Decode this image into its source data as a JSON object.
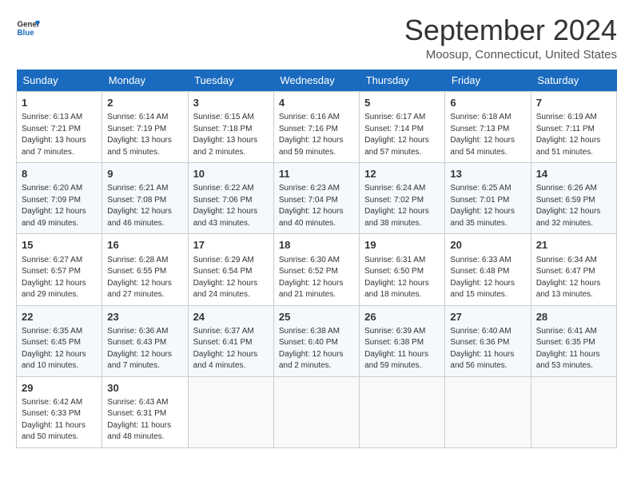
{
  "header": {
    "logo_line1": "General",
    "logo_line2": "Blue",
    "month": "September 2024",
    "location": "Moosup, Connecticut, United States"
  },
  "days_of_week": [
    "Sunday",
    "Monday",
    "Tuesday",
    "Wednesday",
    "Thursday",
    "Friday",
    "Saturday"
  ],
  "weeks": [
    [
      {
        "day": "1",
        "info": "Sunrise: 6:13 AM\nSunset: 7:21 PM\nDaylight: 13 hours\nand 7 minutes."
      },
      {
        "day": "2",
        "info": "Sunrise: 6:14 AM\nSunset: 7:19 PM\nDaylight: 13 hours\nand 5 minutes."
      },
      {
        "day": "3",
        "info": "Sunrise: 6:15 AM\nSunset: 7:18 PM\nDaylight: 13 hours\nand 2 minutes."
      },
      {
        "day": "4",
        "info": "Sunrise: 6:16 AM\nSunset: 7:16 PM\nDaylight: 12 hours\nand 59 minutes."
      },
      {
        "day": "5",
        "info": "Sunrise: 6:17 AM\nSunset: 7:14 PM\nDaylight: 12 hours\nand 57 minutes."
      },
      {
        "day": "6",
        "info": "Sunrise: 6:18 AM\nSunset: 7:13 PM\nDaylight: 12 hours\nand 54 minutes."
      },
      {
        "day": "7",
        "info": "Sunrise: 6:19 AM\nSunset: 7:11 PM\nDaylight: 12 hours\nand 51 minutes."
      }
    ],
    [
      {
        "day": "8",
        "info": "Sunrise: 6:20 AM\nSunset: 7:09 PM\nDaylight: 12 hours\nand 49 minutes."
      },
      {
        "day": "9",
        "info": "Sunrise: 6:21 AM\nSunset: 7:08 PM\nDaylight: 12 hours\nand 46 minutes."
      },
      {
        "day": "10",
        "info": "Sunrise: 6:22 AM\nSunset: 7:06 PM\nDaylight: 12 hours\nand 43 minutes."
      },
      {
        "day": "11",
        "info": "Sunrise: 6:23 AM\nSunset: 7:04 PM\nDaylight: 12 hours\nand 40 minutes."
      },
      {
        "day": "12",
        "info": "Sunrise: 6:24 AM\nSunset: 7:02 PM\nDaylight: 12 hours\nand 38 minutes."
      },
      {
        "day": "13",
        "info": "Sunrise: 6:25 AM\nSunset: 7:01 PM\nDaylight: 12 hours\nand 35 minutes."
      },
      {
        "day": "14",
        "info": "Sunrise: 6:26 AM\nSunset: 6:59 PM\nDaylight: 12 hours\nand 32 minutes."
      }
    ],
    [
      {
        "day": "15",
        "info": "Sunrise: 6:27 AM\nSunset: 6:57 PM\nDaylight: 12 hours\nand 29 minutes."
      },
      {
        "day": "16",
        "info": "Sunrise: 6:28 AM\nSunset: 6:55 PM\nDaylight: 12 hours\nand 27 minutes."
      },
      {
        "day": "17",
        "info": "Sunrise: 6:29 AM\nSunset: 6:54 PM\nDaylight: 12 hours\nand 24 minutes."
      },
      {
        "day": "18",
        "info": "Sunrise: 6:30 AM\nSunset: 6:52 PM\nDaylight: 12 hours\nand 21 minutes."
      },
      {
        "day": "19",
        "info": "Sunrise: 6:31 AM\nSunset: 6:50 PM\nDaylight: 12 hours\nand 18 minutes."
      },
      {
        "day": "20",
        "info": "Sunrise: 6:33 AM\nSunset: 6:48 PM\nDaylight: 12 hours\nand 15 minutes."
      },
      {
        "day": "21",
        "info": "Sunrise: 6:34 AM\nSunset: 6:47 PM\nDaylight: 12 hours\nand 13 minutes."
      }
    ],
    [
      {
        "day": "22",
        "info": "Sunrise: 6:35 AM\nSunset: 6:45 PM\nDaylight: 12 hours\nand 10 minutes."
      },
      {
        "day": "23",
        "info": "Sunrise: 6:36 AM\nSunset: 6:43 PM\nDaylight: 12 hours\nand 7 minutes."
      },
      {
        "day": "24",
        "info": "Sunrise: 6:37 AM\nSunset: 6:41 PM\nDaylight: 12 hours\nand 4 minutes."
      },
      {
        "day": "25",
        "info": "Sunrise: 6:38 AM\nSunset: 6:40 PM\nDaylight: 12 hours\nand 2 minutes."
      },
      {
        "day": "26",
        "info": "Sunrise: 6:39 AM\nSunset: 6:38 PM\nDaylight: 11 hours\nand 59 minutes."
      },
      {
        "day": "27",
        "info": "Sunrise: 6:40 AM\nSunset: 6:36 PM\nDaylight: 11 hours\nand 56 minutes."
      },
      {
        "day": "28",
        "info": "Sunrise: 6:41 AM\nSunset: 6:35 PM\nDaylight: 11 hours\nand 53 minutes."
      }
    ],
    [
      {
        "day": "29",
        "info": "Sunrise: 6:42 AM\nSunset: 6:33 PM\nDaylight: 11 hours\nand 50 minutes."
      },
      {
        "day": "30",
        "info": "Sunrise: 6:43 AM\nSunset: 6:31 PM\nDaylight: 11 hours\nand 48 minutes."
      },
      {
        "day": "",
        "info": ""
      },
      {
        "day": "",
        "info": ""
      },
      {
        "day": "",
        "info": ""
      },
      {
        "day": "",
        "info": ""
      },
      {
        "day": "",
        "info": ""
      }
    ]
  ]
}
